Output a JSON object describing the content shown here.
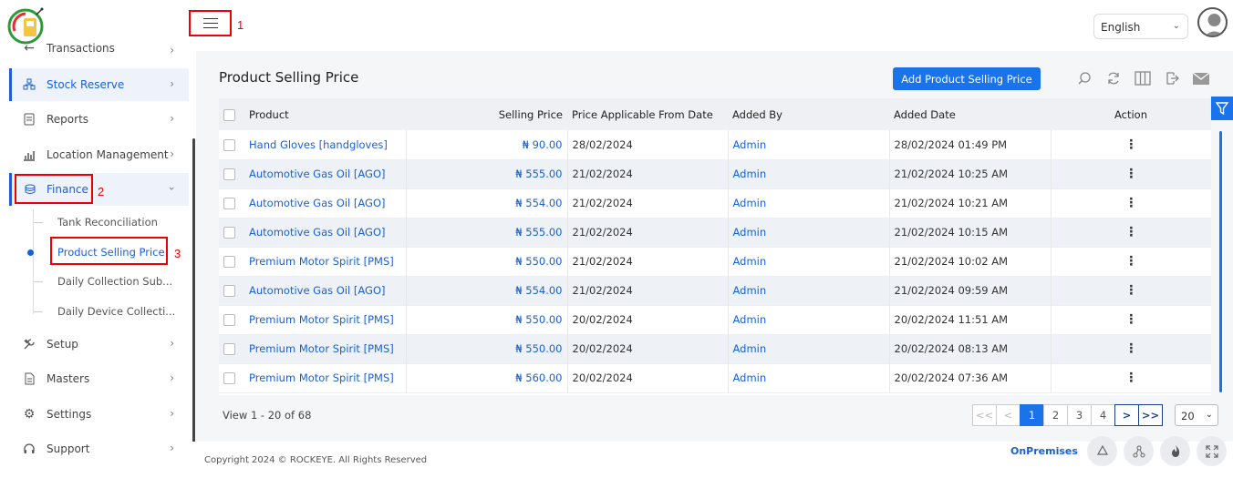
{
  "header": {
    "markers": [
      "1",
      "2",
      "3"
    ],
    "language": "English"
  },
  "sidebar": {
    "items": [
      {
        "label": "Transactions",
        "icon": "arrow-left-icon"
      },
      {
        "label": "Stock Reserve",
        "icon": "stock-icon"
      },
      {
        "label": "Reports",
        "icon": "report-icon"
      },
      {
        "label": "Location Management",
        "icon": "chart-icon"
      },
      {
        "label": "Finance",
        "icon": "coins-icon"
      },
      {
        "label": "Setup",
        "icon": "tools-icon"
      },
      {
        "label": "Masters",
        "icon": "file-icon"
      },
      {
        "label": "Settings",
        "icon": "gear-icon"
      },
      {
        "label": "Support",
        "icon": "headset-icon"
      }
    ],
    "finance_sub": [
      "Tank Reconciliation",
      "Product Selling Price",
      "Daily Collection Sub...",
      "Daily Device Collecti..."
    ]
  },
  "main": {
    "title": "Product Selling Price",
    "add_button": "Add Product Selling Price",
    "columns": [
      "Product",
      "Selling Price",
      "Price Applicable From Date",
      "Added By",
      "Added Date",
      "Action"
    ],
    "rows": [
      [
        "Hand Gloves [handgloves]",
        "₦ 90.00",
        "28/02/2024",
        "Admin",
        "28/02/2024 01:49 PM"
      ],
      [
        "Automotive Gas Oil [AGO]",
        "₦ 555.00",
        "21/02/2024",
        "Admin",
        "21/02/2024 10:25 AM"
      ],
      [
        "Automotive Gas Oil [AGO]",
        "₦ 554.00",
        "21/02/2024",
        "Admin",
        "21/02/2024 10:21 AM"
      ],
      [
        "Automotive Gas Oil [AGO]",
        "₦ 555.00",
        "21/02/2024",
        "Admin",
        "21/02/2024 10:15 AM"
      ],
      [
        "Premium Motor Spirit [PMS]",
        "₦ 550.00",
        "21/02/2024",
        "Admin",
        "21/02/2024 10:02 AM"
      ],
      [
        "Automotive Gas Oil [AGO]",
        "₦ 554.00",
        "21/02/2024",
        "Admin",
        "21/02/2024 09:59 AM"
      ],
      [
        "Premium Motor Spirit [PMS]",
        "₦ 550.00",
        "20/02/2024",
        "Admin",
        "20/02/2024 11:51 AM"
      ],
      [
        "Premium Motor Spirit [PMS]",
        "₦ 550.00",
        "20/02/2024",
        "Admin",
        "20/02/2024 08:13 AM"
      ],
      [
        "Premium Motor Spirit [PMS]",
        "₦ 560.00",
        "20/02/2024",
        "Admin",
        "20/02/2024 07:36 AM"
      ]
    ],
    "view_count": "View 1 - 20 of 68",
    "pager": {
      "first": "<<",
      "prev": "<",
      "pages": [
        "1",
        "2",
        "3",
        "4"
      ],
      "next": ">",
      "last": ">>",
      "page_size": "20"
    }
  },
  "footer": {
    "copyright": "Copyright 2024 © ROCKEYE. All Rights Reserved",
    "mode": "OnPremises"
  },
  "colors": {
    "accent": "#1a73e8",
    "highlight": "#ee0000"
  }
}
